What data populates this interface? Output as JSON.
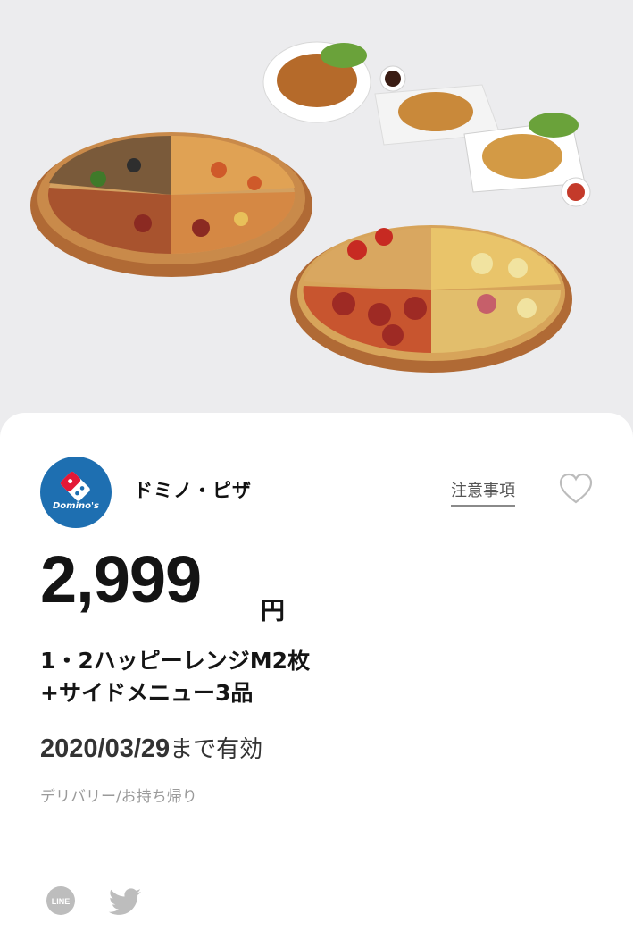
{
  "hero": {
    "image_alt": "pizza-and-sides-photo"
  },
  "shop": {
    "name": "ドミノ・ピザ",
    "logo_text": "Domino's",
    "brand_color": "#1e6fb1"
  },
  "notes_link": "注意事項",
  "price": {
    "amount": "2,999",
    "unit": "円"
  },
  "offer": {
    "line1": "1・2ハッピーレンジM2枚",
    "line2": "+サイドメニュー3品"
  },
  "validity": {
    "date": "2020/03/29",
    "suffix": "まで有効"
  },
  "service_type": "デリバリー/お持ち帰り",
  "share": {
    "line_label": "LINE",
    "twitter_icon": "twitter-bird-icon"
  }
}
